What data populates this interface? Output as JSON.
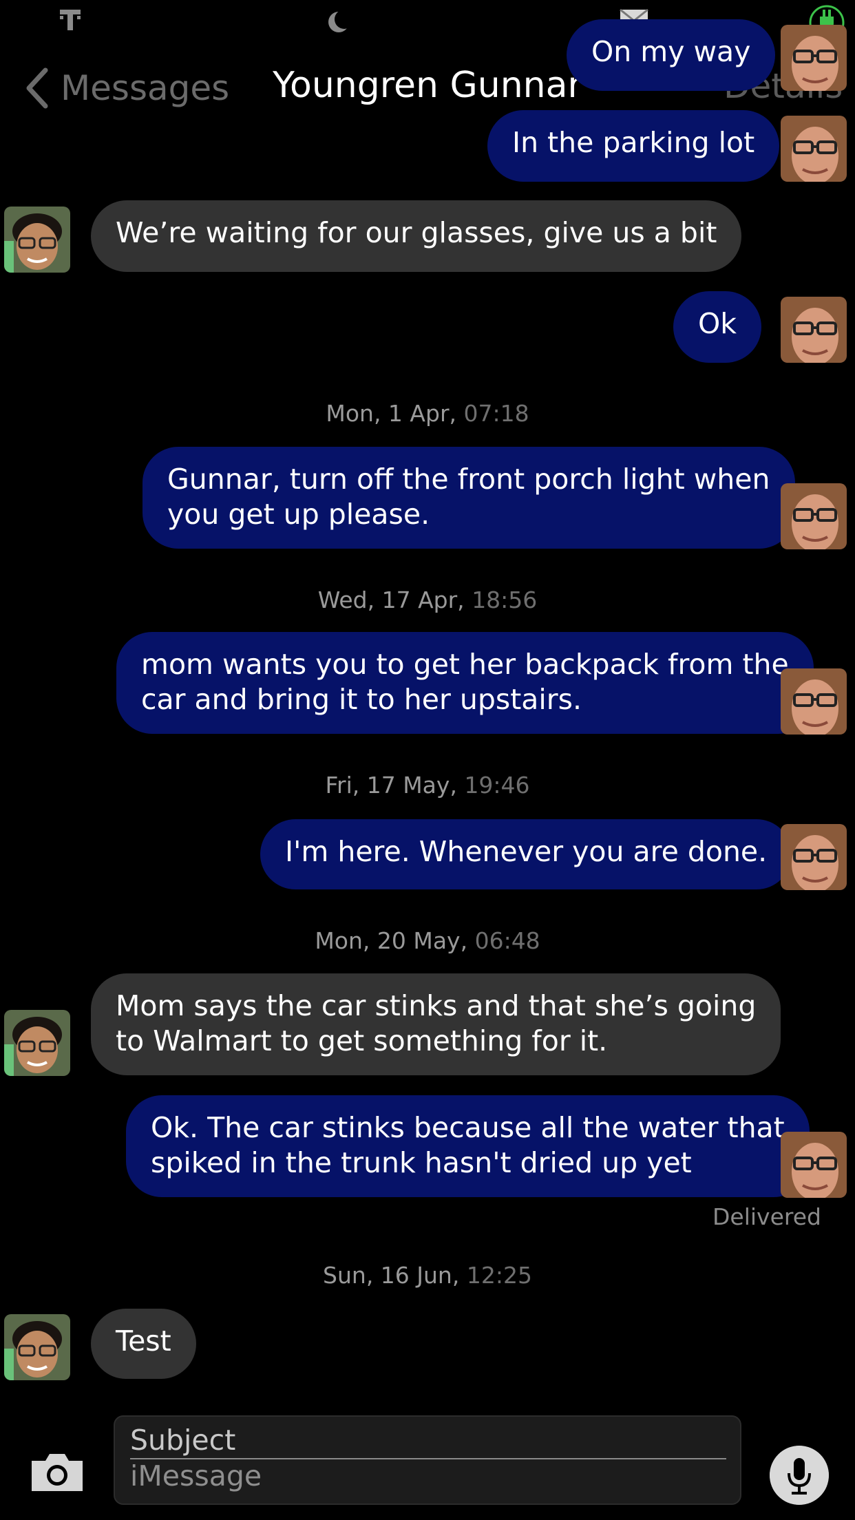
{
  "nav": {
    "back_label": "Messages",
    "title": "Youngren Gunnar",
    "details_label": "Details"
  },
  "messages": [
    {
      "dir": "out",
      "text": "On my way"
    },
    {
      "dir": "out",
      "text": "In the parking lot"
    },
    {
      "dir": "in",
      "text": "We’re waiting for our glasses, give us a bit"
    },
    {
      "dir": "out",
      "text": "Ok"
    },
    {
      "dir": "out",
      "lines": [
        "Gunnar, turn off the front porch light when",
        "you get up please."
      ]
    },
    {
      "dir": "out",
      "lines": [
        "mom wants you to get her backpack from the",
        "car and bring it to her upstairs."
      ]
    },
    {
      "dir": "out",
      "text": "I'm here. Whenever you are done."
    },
    {
      "dir": "in",
      "lines": [
        "Mom says the car stinks and that she’s going",
        "to Walmart to get something for it."
      ]
    },
    {
      "dir": "out",
      "lines": [
        "Ok. The car stinks because all the water that",
        "spiked in the trunk hasn't dried up yet"
      ]
    },
    {
      "dir": "in",
      "text": "Test"
    }
  ],
  "timestamps": [
    {
      "date": "Mon, 1 Apr,",
      "time": "07:18"
    },
    {
      "date": "Wed, 17 Apr,",
      "time": "18:56"
    },
    {
      "date": "Fri, 17 May,",
      "time": "19:46"
    },
    {
      "date": "Mon, 20 May,",
      "time": "06:48"
    },
    {
      "date": "Sun, 16 Jun,",
      "time": "12:25"
    }
  ],
  "status": {
    "delivered": "Delivered"
  },
  "composer": {
    "subject_placeholder": "Subject",
    "message_placeholder": "iMessage"
  },
  "icons": {
    "carrier": "t-mobile-logo-icon",
    "do_not_disturb": "moon-icon",
    "mail": "envelope-icon",
    "battery": "charging-plug-icon",
    "back": "chevron-left-icon",
    "camera": "camera-icon",
    "mic": "microphone-icon"
  },
  "colors": {
    "outgoing_bubble": "#061268",
    "incoming_bubble": "#333333",
    "background": "#000000",
    "battery_green": "#3cc24a"
  }
}
